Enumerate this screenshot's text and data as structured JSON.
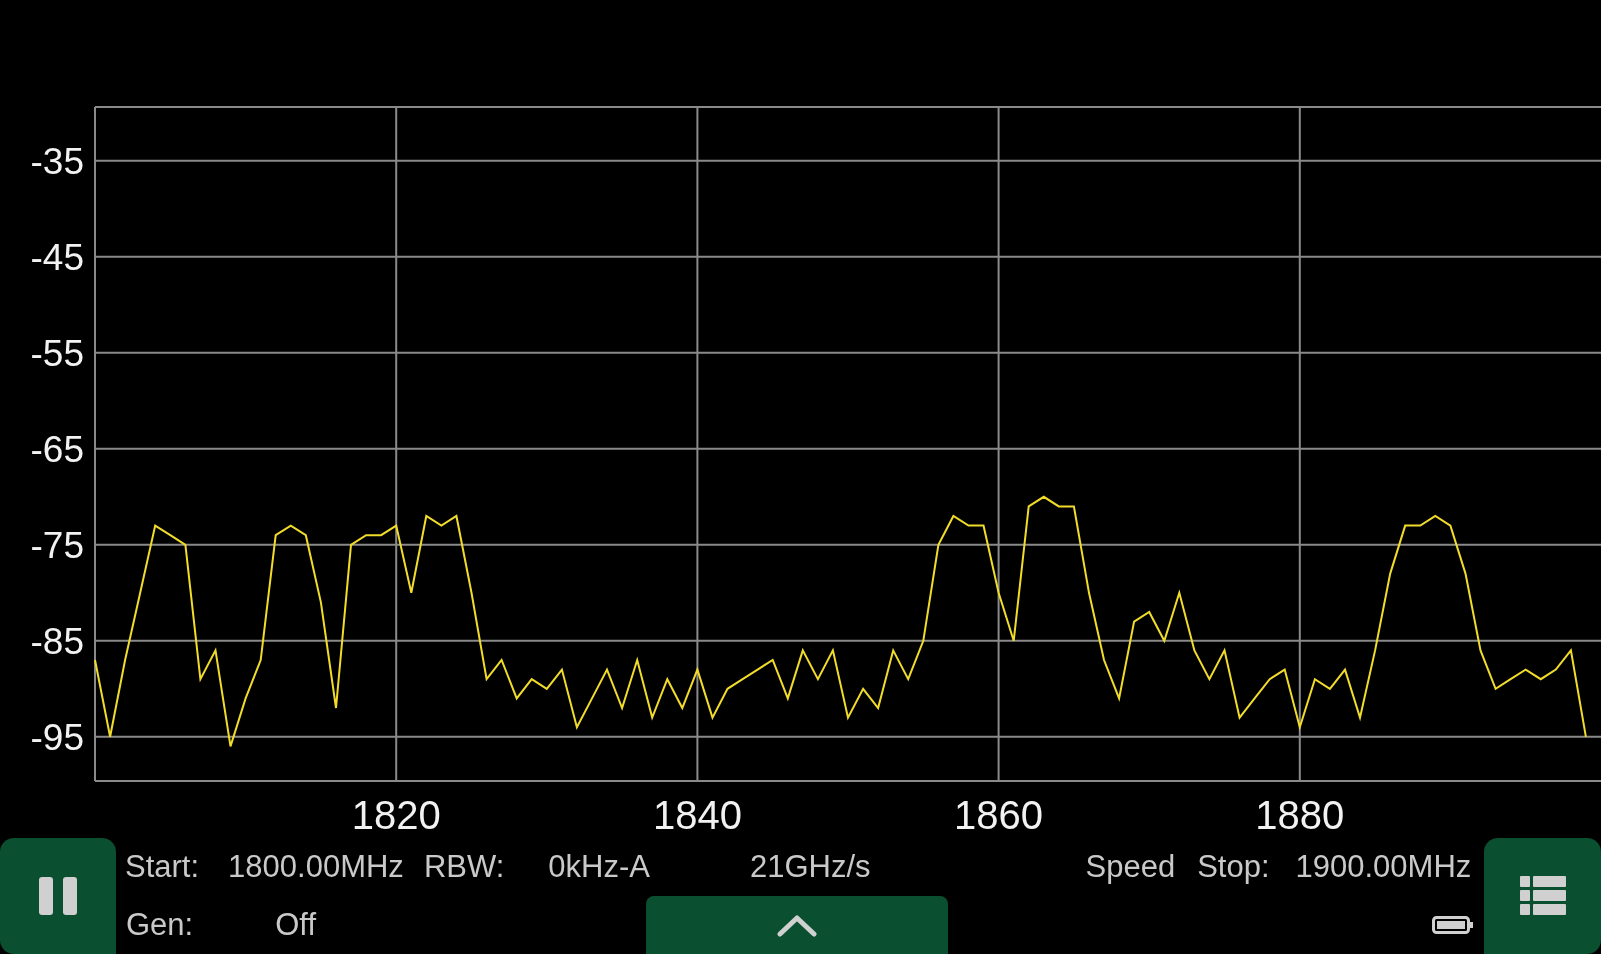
{
  "chart": {
    "chart_data": {
      "type": "line",
      "grid": true,
      "xlim": [
        1800,
        1900
      ],
      "ylim": [
        -99.6,
        -29.4
      ],
      "xticks": [
        1820,
        1840,
        1860,
        1880
      ],
      "yticks": [
        -35,
        -45,
        -55,
        -65,
        -75,
        -85,
        -95
      ],
      "x": [
        1800,
        1801,
        1802,
        1803,
        1804,
        1805,
        1806,
        1807,
        1808,
        1809,
        1810,
        1811,
        1812,
        1813,
        1814,
        1815,
        1816,
        1817,
        1818,
        1819,
        1820,
        1821,
        1822,
        1823,
        1824,
        1825,
        1826,
        1827,
        1828,
        1829,
        1830,
        1831,
        1832,
        1833,
        1834,
        1835,
        1836,
        1837,
        1838,
        1839,
        1840,
        1841,
        1842,
        1843,
        1844,
        1845,
        1846,
        1847,
        1848,
        1849,
        1850,
        1851,
        1852,
        1853,
        1854,
        1855,
        1856,
        1857,
        1858,
        1859,
        1860,
        1861,
        1862,
        1863,
        1864,
        1865,
        1866,
        1867,
        1868,
        1869,
        1870,
        1871,
        1872,
        1873,
        1874,
        1875,
        1876,
        1877,
        1878,
        1879,
        1880,
        1881,
        1882,
        1883,
        1884,
        1885,
        1886,
        1887,
        1888,
        1889,
        1890,
        1891,
        1892,
        1893,
        1894,
        1895,
        1896,
        1897,
        1898,
        1899
      ],
      "series": [
        {
          "color": "#f2dc2a",
          "values": [
            -87,
            -95,
            -87,
            -80,
            -73,
            -74,
            -75,
            -89,
            -86,
            -96,
            -91,
            -87,
            -74,
            -73,
            -74,
            -81,
            -92,
            -75,
            -74,
            -74,
            -73,
            -80,
            -72,
            -73,
            -72,
            -80,
            -89,
            -87,
            -91,
            -89,
            -90,
            -88,
            -94,
            -91,
            -88,
            -92,
            -87,
            -93,
            -89,
            -92,
            -88,
            -93,
            -90,
            -89,
            -88,
            -87,
            -91,
            -86,
            -89,
            -86,
            -93,
            -90,
            -92,
            -86,
            -89,
            -85,
            -75,
            -72,
            -73,
            -73,
            -80,
            -85,
            -71,
            -70,
            -71,
            -71,
            -80,
            -87,
            -91,
            -83,
            -82,
            -85,
            -80,
            -86,
            -89,
            -86,
            -93,
            -91,
            -89,
            -88,
            -94,
            -89,
            -90,
            -88,
            -93,
            -86,
            -78,
            -73,
            -73,
            -72,
            -73,
            -78,
            -86,
            -90,
            -89,
            -88,
            -89,
            -88,
            -86,
            -95
          ]
        }
      ]
    }
  },
  "status": {
    "start_label": "Start:",
    "start_value": "1800.00MHz",
    "rbw_label": "RBW:",
    "rbw_value": "0kHz-A",
    "sweep_rate": "21GHz/s",
    "speed_label": "Speed",
    "stop_label": "Stop:",
    "stop_value": "1900.00MHz",
    "gen_label": "Gen:",
    "gen_value": "Off"
  }
}
